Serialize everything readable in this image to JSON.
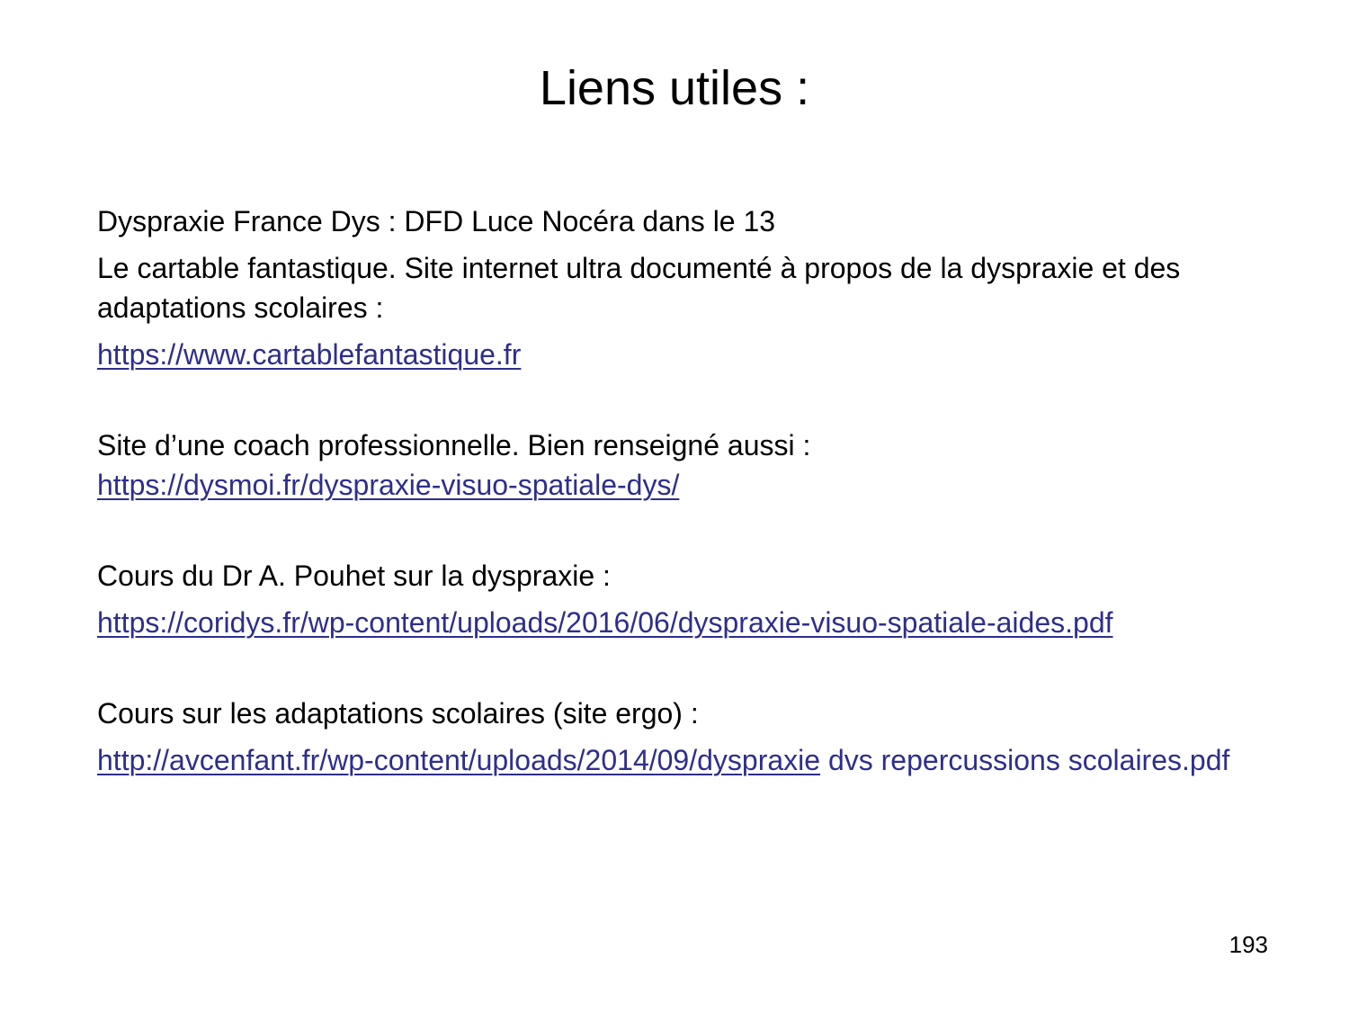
{
  "slide": {
    "title": "Liens utiles :",
    "page_number": "193"
  },
  "colors": {
    "link": "#2e2e8c",
    "text": "#000000",
    "background": "#ffffff"
  },
  "blocks": [
    {
      "text": "Dyspraxie France Dys : DFD  Luce Nocéra dans le 13"
    },
    {
      "text": "Le cartable fantastique. Site internet ultra documenté à propos de la dyspraxie et des adaptations scolaires :",
      "link": "https://www.cartablefantastique.fr"
    },
    {
      "text": "Site d’une coach professionnelle. Bien renseigné aussi :",
      "link": "https://dysmoi.fr/dyspraxie-visuo-spatiale-dys/"
    },
    {
      "text": "Cours du Dr A. Pouhet sur la dyspraxie :",
      "link": "https://coridys.fr/wp-content/uploads/2016/06/dyspraxie-visuo-spatiale-aides.pdf"
    },
    {
      "text": "Cours sur les adaptations scolaires (site ergo) :",
      "link": "http://avcenfant.fr/wp-content/uploads/2014/09/dyspraxie",
      "link_tail": " dvs repercussions scolaires.pdf"
    }
  ]
}
